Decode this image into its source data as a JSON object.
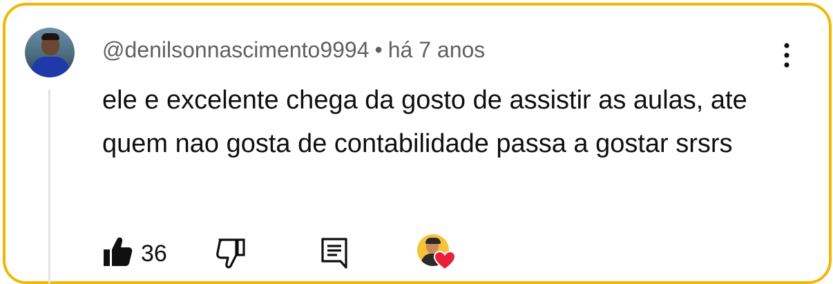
{
  "comment": {
    "author": "@denilsonnascimento9994",
    "separator": "•",
    "time": "há 7 anos",
    "text": "ele e excelente chega da gosto de assistir as aulas, ate quem nao gosta de contabilidade passa a gostar srsrs",
    "like_count": "36"
  },
  "icons": {
    "more": "more-vertical-icon",
    "like": "thumb-up-filled-icon",
    "dislike": "thumb-down-outline-icon",
    "reply": "comment-reply-icon",
    "creator_heart": "creator-heart-icon"
  },
  "colors": {
    "border": "#f2b705",
    "meta_text": "#606060",
    "body_text": "#0f0f0f",
    "heart": "#e8213a"
  }
}
